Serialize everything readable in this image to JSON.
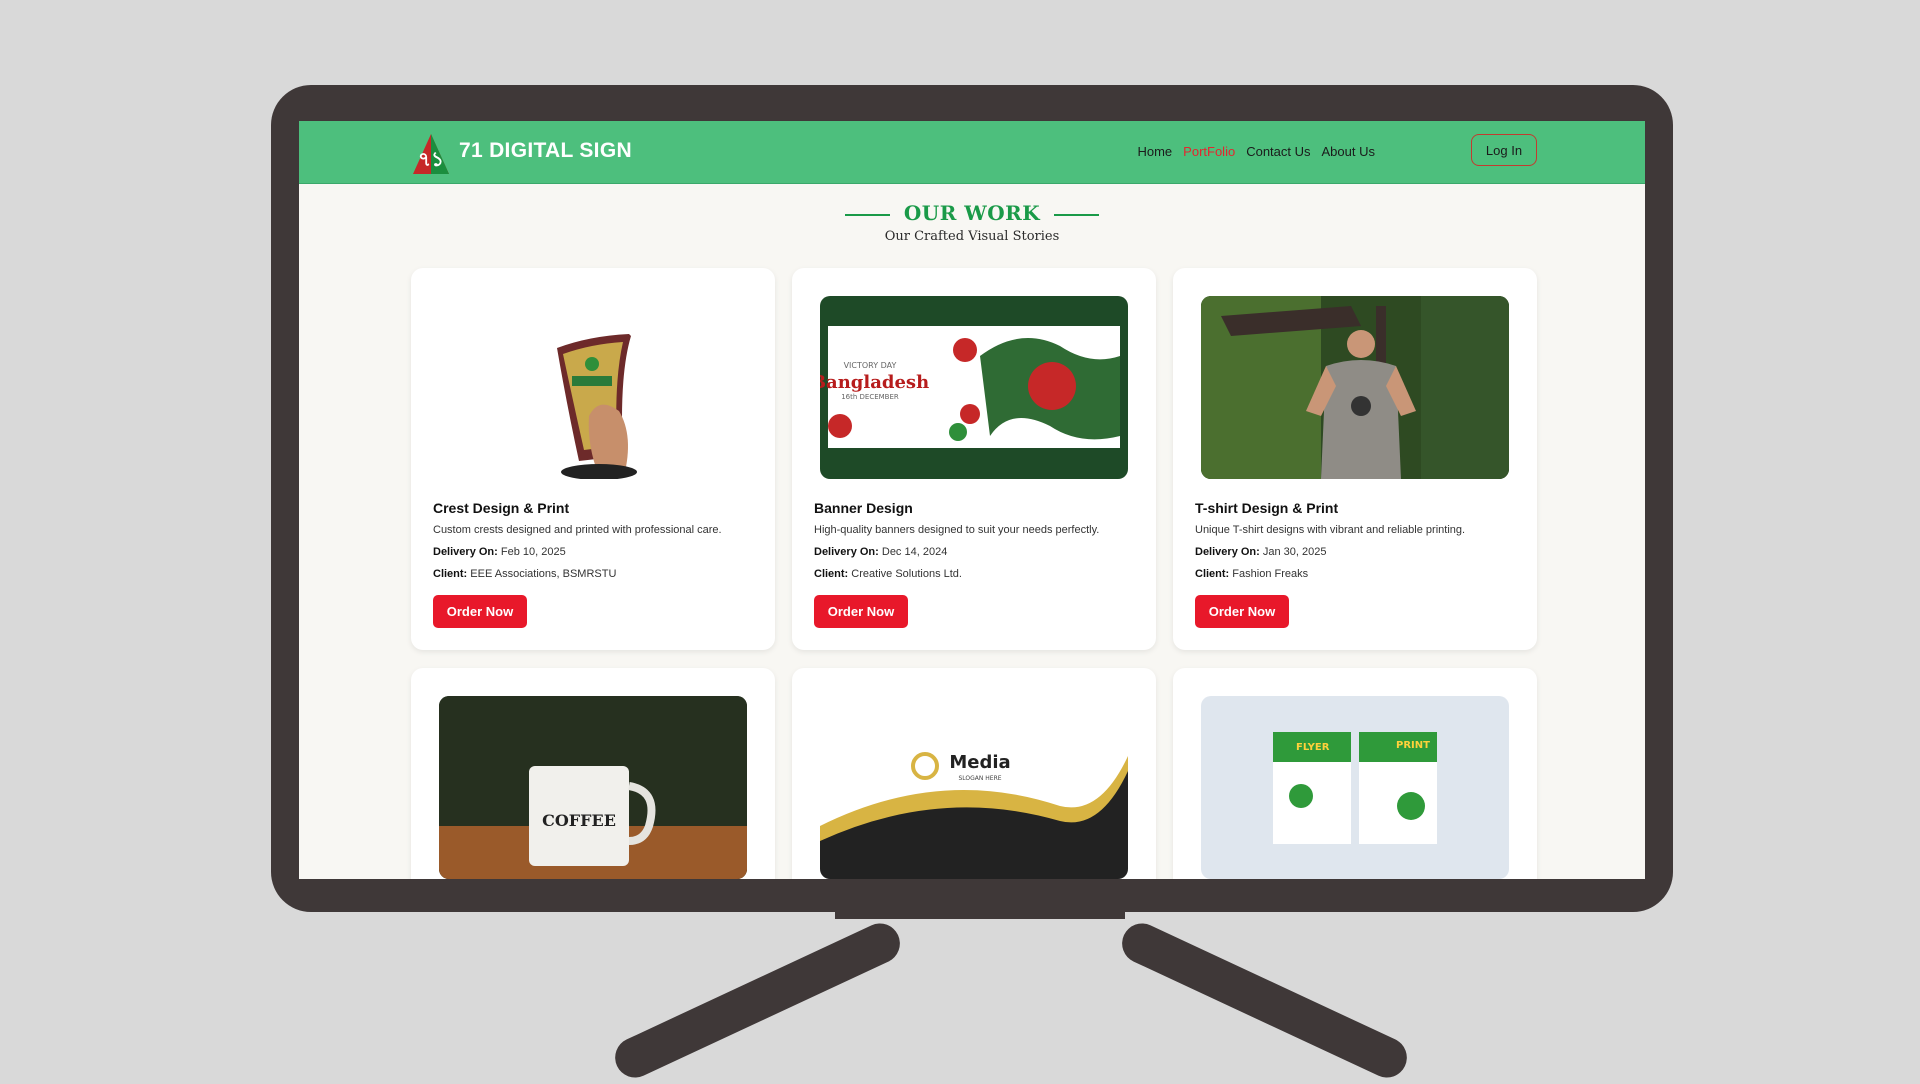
{
  "header": {
    "brand": "71 DIGITAL SIGN",
    "nav": [
      "Home",
      "PortFolio",
      "Contact Us",
      "About Us"
    ],
    "active_nav": "PortFolio",
    "login_label": "Log In"
  },
  "section": {
    "title": "OUR WORK",
    "subtitle": "Our Crafted Visual Stories"
  },
  "cards": [
    {
      "title": "Crest Design & Print",
      "desc": "Custom crests designed and printed with professional care.",
      "delivery_label": "Delivery On:",
      "delivery": "Feb 10, 2025",
      "client_label": "Client:",
      "client": "EEE Associations, BSMRSTU",
      "button": "Order Now"
    },
    {
      "title": "Banner Design",
      "desc": "High-quality banners designed to suit your needs perfectly.",
      "delivery_label": "Delivery On:",
      "delivery": "Dec 14, 2024",
      "client_label": "Client:",
      "client": "Creative Solutions Ltd.",
      "button": "Order Now",
      "image_text": {
        "top": "VICTORY DAY",
        "main": "Bangladesh",
        "bottom": "16th DECEMBER"
      }
    },
    {
      "title": "T-shirt Design & Print",
      "desc": "Unique T-shirt designs with vibrant and reliable printing.",
      "delivery_label": "Delivery On:",
      "delivery": "Jan 30, 2025",
      "client_label": "Client:",
      "client": "Fashion Freaks",
      "button": "Order Now"
    }
  ],
  "bottom_cards": [
    {
      "image_text": "COFFEE"
    },
    {
      "image_text": "Media",
      "image_sub": "SLOGAN HERE"
    },
    {
      "image_text": "FLYER",
      "image_sub": "PRINT"
    }
  ],
  "colors": {
    "header_bg": "#4dbf7d",
    "accent_red": "#e8182a",
    "title_green": "#1a9a48"
  }
}
